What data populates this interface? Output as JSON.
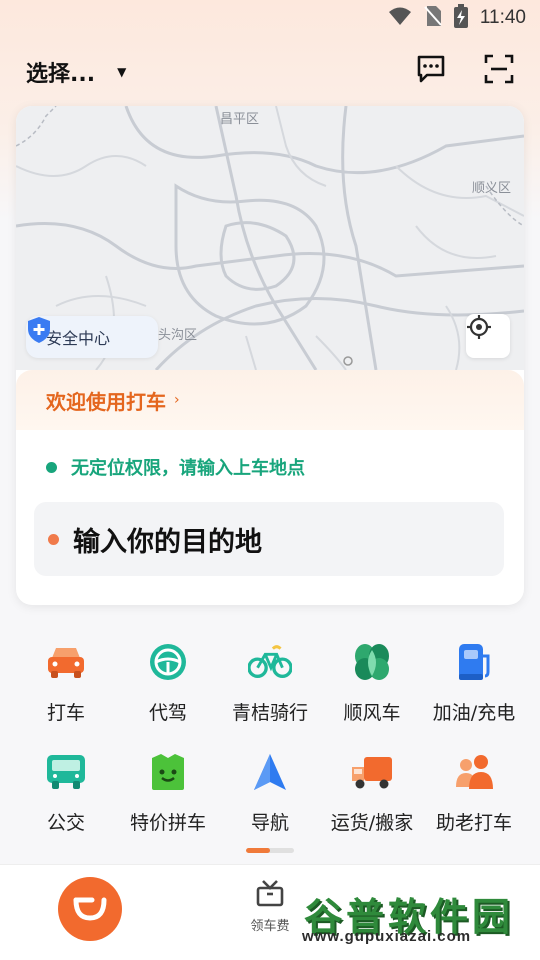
{
  "status_bar": {
    "time": "11:40"
  },
  "header": {
    "city": "选择..."
  },
  "map": {
    "labels": {
      "changping": "昌平区",
      "shunyi": "顺义区",
      "mentougou": "头沟区"
    },
    "safety_label": "安全中心"
  },
  "welcome": {
    "text": "欢迎使用打车",
    "chevron": "›"
  },
  "location_notice": "无定位权限，请输入上车地点",
  "destination_placeholder": "输入你的目的地",
  "services": [
    {
      "label": "打车",
      "icon": "car-icon",
      "color": "#f26a2e"
    },
    {
      "label": "代驾",
      "icon": "steering-wheel-icon",
      "color": "#1fb89a"
    },
    {
      "label": "青桔骑行",
      "icon": "bicycle-icon",
      "color": "#1fb89a"
    },
    {
      "label": "顺风车",
      "icon": "leaf-icon",
      "color": "#1a9a6c"
    },
    {
      "label": "加油/充电",
      "icon": "fuel-pump-icon",
      "color": "#2f7bf0"
    },
    {
      "label": "公交",
      "icon": "bus-icon",
      "color": "#1fb89a"
    },
    {
      "label": "特价拼车",
      "icon": "bag-icon",
      "color": "#4cc23a"
    },
    {
      "label": "导航",
      "icon": "navigation-arrow-icon",
      "color": "#2f7bf0"
    },
    {
      "label": "运货/搬家",
      "icon": "truck-icon",
      "color": "#f26a2e"
    },
    {
      "label": "助老打车",
      "icon": "elderly-icon",
      "color": "#f26a2e"
    }
  ],
  "bottom_nav": {
    "coupon_label": "领车费"
  },
  "watermark": {
    "main": "谷普软件园",
    "url": "www.gupuxiazai.com"
  },
  "colors": {
    "accent": "#f26a2e",
    "green": "#18a57c"
  }
}
